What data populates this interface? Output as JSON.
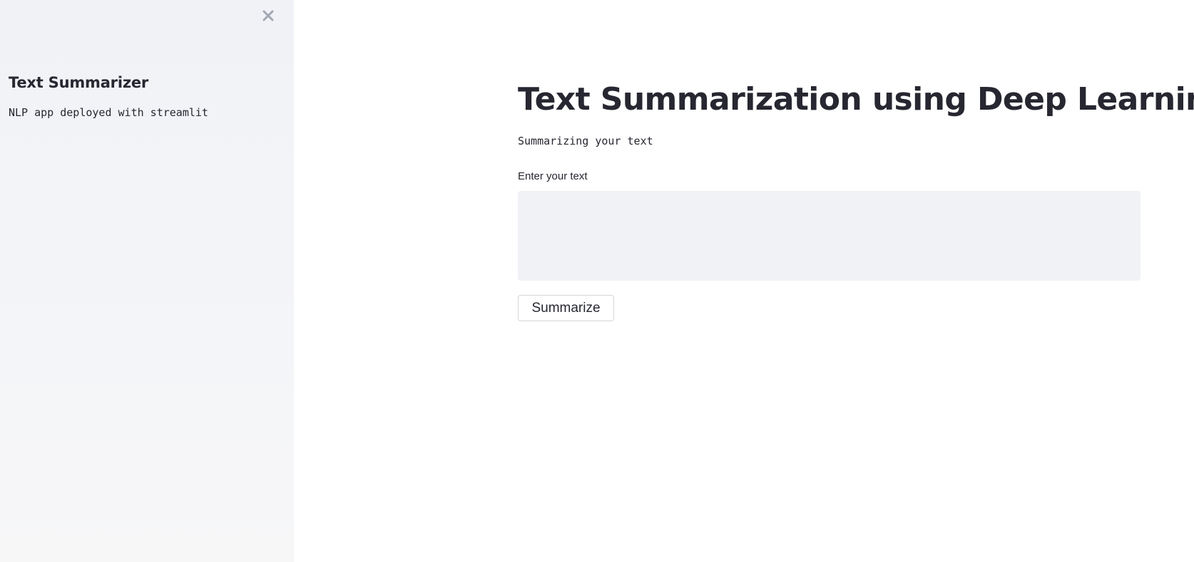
{
  "sidebar": {
    "close_icon": "close-icon",
    "title": "Text Summarizer",
    "caption": "NLP app deployed with streamlit"
  },
  "main": {
    "title": "Text Summarization using Deep Learning",
    "subtitle": "Summarizing your text",
    "input": {
      "label": "Enter your text",
      "value": "",
      "placeholder": ""
    },
    "button_label": "Summarize"
  },
  "colors": {
    "sidebar_bg": "#f0f2f6",
    "text": "#262730",
    "input_bg": "#f0f2f6",
    "close_icon": "#a3a8b4"
  }
}
